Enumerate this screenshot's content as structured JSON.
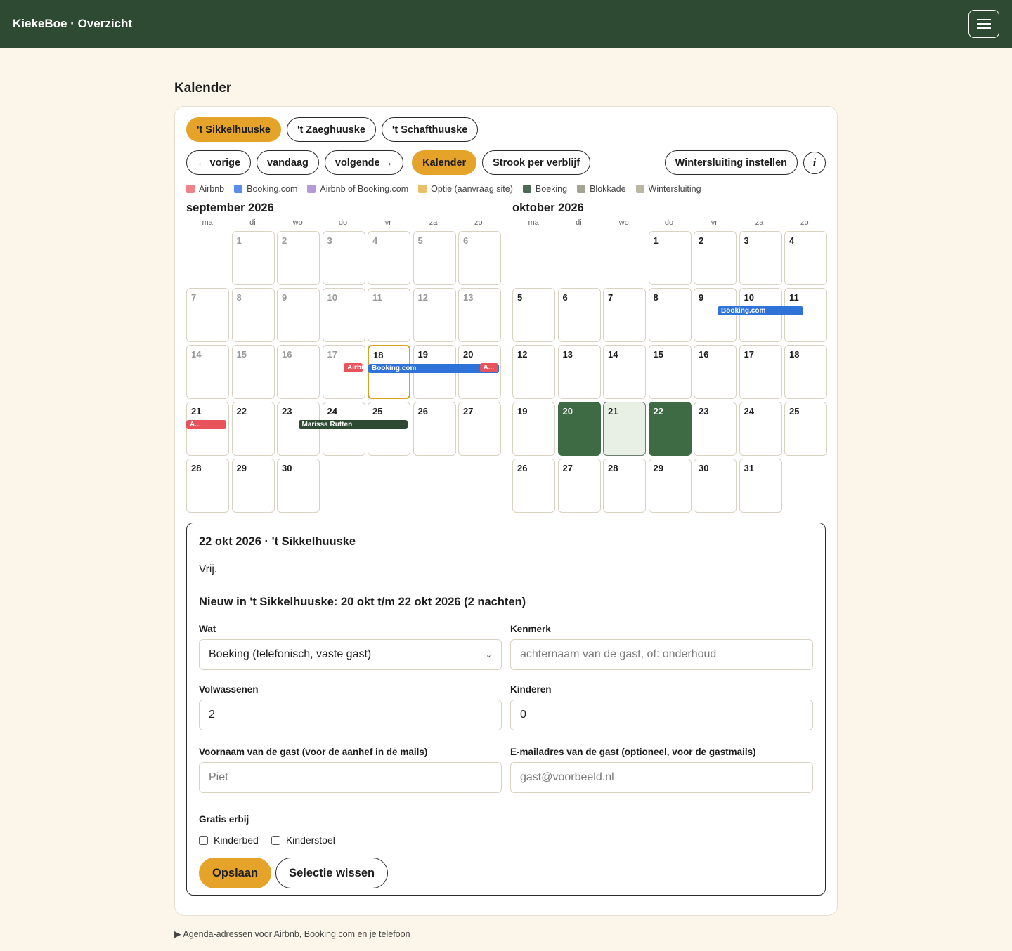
{
  "app": {
    "title": "KiekeBoe · Overzicht"
  },
  "page": {
    "section_title": "Kalender"
  },
  "properties": [
    {
      "label": "'t Sikkelhuuske",
      "active": true
    },
    {
      "label": "'t Zaeghuuske",
      "active": false
    },
    {
      "label": "'t Schafthuuske",
      "active": false
    }
  ],
  "nav": {
    "prev": "← vorige",
    "today": "vandaag",
    "next": "volgende →",
    "view_calendar": "Kalender",
    "view_strip": "Strook per verblijf",
    "winter": "Wintersluiting instellen",
    "info": "i"
  },
  "legend": [
    {
      "label": "Airbnb",
      "color": "#f0838a"
    },
    {
      "label": "Booking.com",
      "color": "#5b8def"
    },
    {
      "label": "Airbnb of Booking.com",
      "color": "#b59ad6"
    },
    {
      "label": "Optie (aanvraag site)",
      "color": "#e9c06a"
    },
    {
      "label": "Boeking",
      "color": "#4d6b52"
    },
    {
      "label": "Blokkade",
      "color": "#a3a396"
    },
    {
      "label": "Wintersluiting",
      "color": "#bdb6a3"
    }
  ],
  "weekdays": [
    "ma",
    "di",
    "wo",
    "do",
    "vr",
    "za",
    "zo"
  ],
  "months": [
    {
      "title": "september 2026",
      "offset": 1,
      "days": 30,
      "past_until": 17,
      "today": 18,
      "selected": [],
      "range": [],
      "bars": [
        {
          "day": 17,
          "span": 1,
          "label": "Airbnb",
          "kind": "airbnb",
          "start": 0.5
        },
        {
          "day": 18,
          "span": 3,
          "label": "Booking.com",
          "kind": "booking",
          "start": 0
        },
        {
          "day": 20,
          "span": 1,
          "label": "A...",
          "kind": "airbnb",
          "start": 0.5
        },
        {
          "day": 21,
          "span": 1,
          "label": "A...",
          "kind": "airbnb",
          "start": 0
        },
        {
          "day": 23,
          "span": 3,
          "label": "Marissa Rutten",
          "kind": "blok",
          "start": 0.5
        }
      ]
    },
    {
      "title": "oktober 2026",
      "offset": 3,
      "days": 31,
      "past_until": 0,
      "today": 0,
      "selected": [
        20,
        22
      ],
      "range": [
        21
      ],
      "bars": [
        {
          "day": 10,
          "span": 2,
          "label": "Booking.com",
          "kind": "booking",
          "start": -0.5
        }
      ]
    }
  ],
  "detail": {
    "title": "22 okt 2026 · 't Sikkelhuuske",
    "status": "Vrij.",
    "new_title": "Nieuw in 't Sikkelhuuske: 20 okt t/m 22 okt 2026 (2 nachten)",
    "form": {
      "wat_label": "Wat",
      "wat_value": "Boeking (telefonisch, vaste gast)",
      "kenmerk_label": "Kenmerk",
      "kenmerk_placeholder": "achternaam van de gast, of: onderhoud",
      "volwassenen_label": "Volwassenen",
      "volwassenen_value": "2",
      "kinderen_label": "Kinderen",
      "kinderen_value": "0",
      "voornaam_label": "Voornaam van de gast (voor de aanhef in de mails)",
      "voornaam_placeholder": "Piet",
      "email_label": "E-mailadres van de gast (optioneel, voor de gastmails)",
      "email_placeholder": "gast@voorbeeld.nl",
      "extras_label": "Gratis erbij",
      "extra_1": "Kinderbed",
      "extra_2": "Kinderstoel",
      "save": "Opslaan",
      "clear": "Selectie wissen"
    }
  },
  "footer": {
    "summary": "▶ Agenda-adressen voor Airbnb, Booking.com en je telefoon"
  }
}
